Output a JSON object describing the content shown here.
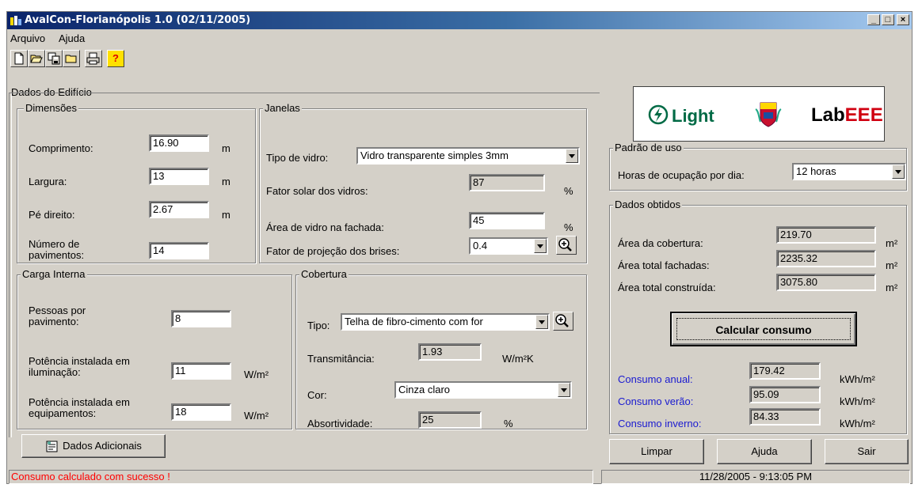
{
  "window": {
    "title": "AvalCon-Florianópolis 1.0 (02/11/2005)",
    "controls": {
      "minimize": "_",
      "maximize": "□",
      "close": "×"
    }
  },
  "menu": {
    "items": [
      "Arquivo",
      "Ajuda"
    ]
  },
  "toolbar": {
    "icons": [
      "new-file-icon",
      "open-folder-icon",
      "save-icon",
      "folder-icon",
      "print-icon",
      "help-icon"
    ],
    "help_glyph": "?"
  },
  "building": {
    "group_title": "Dados do Edifício",
    "dimensions": {
      "title": "Dimensões",
      "length_label": "Comprimento:",
      "length_value": "16.90",
      "length_unit": "m",
      "width_label": "Largura:",
      "width_value": "13",
      "width_unit": "m",
      "height_label": "Pé direito:",
      "height_value": "2.67",
      "height_unit": "m",
      "floors_label": "Número de pavimentos:",
      "floors_value": "14"
    },
    "windows": {
      "title": "Janelas",
      "glass_type_label": "Tipo de vidro:",
      "glass_type_value": "Vidro transparente simples 3mm",
      "solar_factor_label": "Fator solar dos vidros:",
      "solar_factor_value": "87",
      "solar_factor_unit": "%",
      "glass_area_label": "Área de vidro na fachada:",
      "glass_area_value": "45",
      "glass_area_unit": "%",
      "shading_label": "Fator de projeção dos brises:",
      "shading_value": "0.4"
    },
    "internal_load": {
      "title": "Carga Interna",
      "people_label": "Pessoas por pavimento:",
      "people_value": "8",
      "lighting_label": "Potência instalada em iluminação:",
      "lighting_value": "11",
      "lighting_unit": "W/m²",
      "equipment_label": "Potência instalada em equipamentos:",
      "equipment_value": "18",
      "equipment_unit": "W/m²"
    },
    "roof": {
      "title": "Cobertura",
      "type_label": "Tipo:",
      "type_value": "Telha de fibro-cimento com for",
      "transmittance_label": "Transmitância:",
      "transmittance_value": "1.93",
      "transmittance_unit": "W/m²K",
      "color_label": "Cor:",
      "color_value": "Cinza claro",
      "absorptivity_label": "Absortividade:",
      "absorptivity_value": "25",
      "absorptivity_unit": "%"
    },
    "additional_button": "Dados Adicionais"
  },
  "logos": {
    "light": "Light",
    "labeee_prefix": "Lab",
    "labeee_suffix": "EEE"
  },
  "usage": {
    "title": "Padrão de uso",
    "hours_label": "Horas de ocupação por dia:",
    "hours_value": "12 horas"
  },
  "results": {
    "title": "Dados obtidos",
    "roof_area_label": "Área da cobertura:",
    "roof_area_value": "219.70",
    "roof_area_unit": "m²",
    "facade_area_label": "Área total fachadas:",
    "facade_area_value": "2235.32",
    "facade_area_unit": "m²",
    "built_area_label": "Área total construída:",
    "built_area_value": "3075.80",
    "built_area_unit": "m²",
    "calc_button": "Calcular consumo",
    "annual_label": "Consumo anual:",
    "annual_value": "179.42",
    "annual_unit": "kWh/m²",
    "summer_label": "Consumo verão:",
    "summer_value": "95.09",
    "summer_unit": "kWh/m²",
    "winter_label": "Consumo inverno:",
    "winter_value": "84.33",
    "winter_unit": "kWh/m²"
  },
  "actions": {
    "clear": "Limpar",
    "help": "Ajuda",
    "exit": "Sair"
  },
  "statusbar": {
    "message": "Consumo calculado com sucesso !",
    "datetime": "11/28/2005  -  9:13:05 PM"
  },
  "colors": {
    "title_start": "#0a246a",
    "title_end": "#a6caf0",
    "status_message": "#ff0000",
    "consumption_label": "#1a1ad0",
    "face": "#d4d0c8"
  }
}
